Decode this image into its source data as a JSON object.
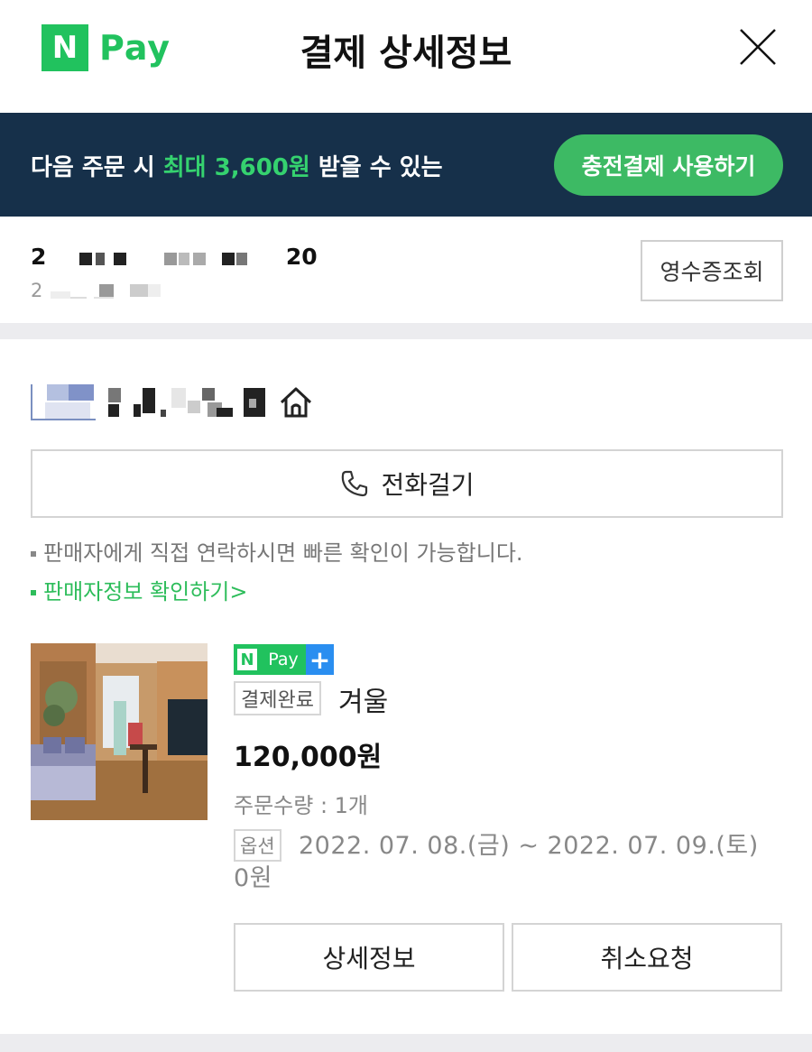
{
  "header": {
    "logo_n": "N",
    "logo_pay": "Pay",
    "title": "결제 상세정보",
    "close_icon": "close-icon"
  },
  "banner": {
    "text_prefix": "다음 주문 시 ",
    "text_highlight": "최대 3,600원",
    "text_suffix": " 받을 수 있는",
    "button_label": "충전결제 사용하기",
    "bg_color": "#16304a",
    "accent_color": "#35d26f"
  },
  "order": {
    "number_visible_prefix": "2",
    "number_visible_suffix": "20",
    "date_visible_prefix": "2",
    "receipt_button": "영수증조회"
  },
  "seller": {
    "home_icon": "home-icon",
    "call_button": "전화걸기",
    "call_icon": "phone-icon",
    "note": "판매자에게 직접 연락하시면 빠른 확인이 가능합니다.",
    "info_link": "판매자정보 확인하기",
    "link_chevron": ">"
  },
  "product": {
    "badge_n": "N",
    "badge_pay": "Pay",
    "badge_plus": "+",
    "status": "결제완료",
    "name": "겨울",
    "price": "120,000원",
    "quantity": "주문수량 : 1개",
    "option_label": "옵션",
    "option_value": "2022. 07. 08.(금) ~ 2022. 07. 09.(토) 0원",
    "detail_button": "상세정보",
    "cancel_button": "취소요청"
  }
}
